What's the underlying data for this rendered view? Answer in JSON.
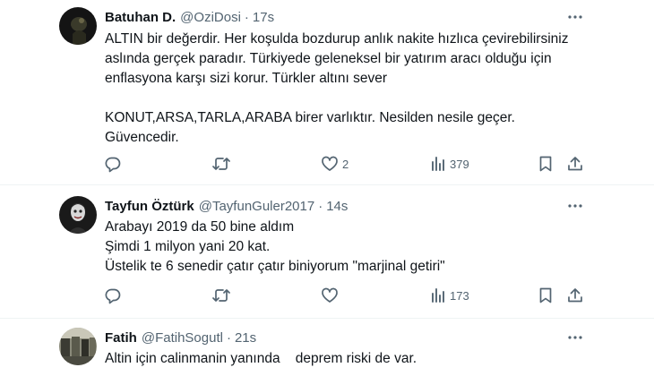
{
  "tweets": [
    {
      "name": "Batuhan D.",
      "handle": "@OziDosi",
      "time": "17s",
      "avatar": "avatar-dark-icon",
      "lines": [
        "ALTIN bir değerdir. Her koşulda bozdurup anlık nakite hızlıca çevirebilirsiniz",
        "aslında gerçek paradır. Türkiyede geleneksel bir yatırım aracı olduğu için",
        "enflasyona karşı sizi korur. Türkler altını sever",
        "",
        "KONUT,ARSA,TARLA,ARABA birer varlıktır. Nesilden nesile geçer.",
        "Güvencedir."
      ],
      "likes": "2",
      "views": "379"
    },
    {
      "name": "Tayfun Öztürk",
      "handle": "@TayfunGuler2017",
      "time": "14s",
      "avatar": "avatar-joker-icon",
      "lines": [
        "Arabayı 2019 da 50 bine aldım",
        "Şimdi 1 milyon yani 20 kat.",
        "Üstelik te 6 senedir çatır çatır biniyorum \"marjinal getiri\""
      ],
      "likes": "",
      "views": "173"
    },
    {
      "name": "Fatih",
      "handle": "@FatihSogutl",
      "time": "21s",
      "avatar": "avatar-photo-icon",
      "lines": [
        "Altin için calinmanin yanında    deprem riski de var."
      ]
    }
  ],
  "separator": "·",
  "colors": {
    "text": "#0f1419",
    "muted": "#536471",
    "border": "#eff3f4"
  }
}
